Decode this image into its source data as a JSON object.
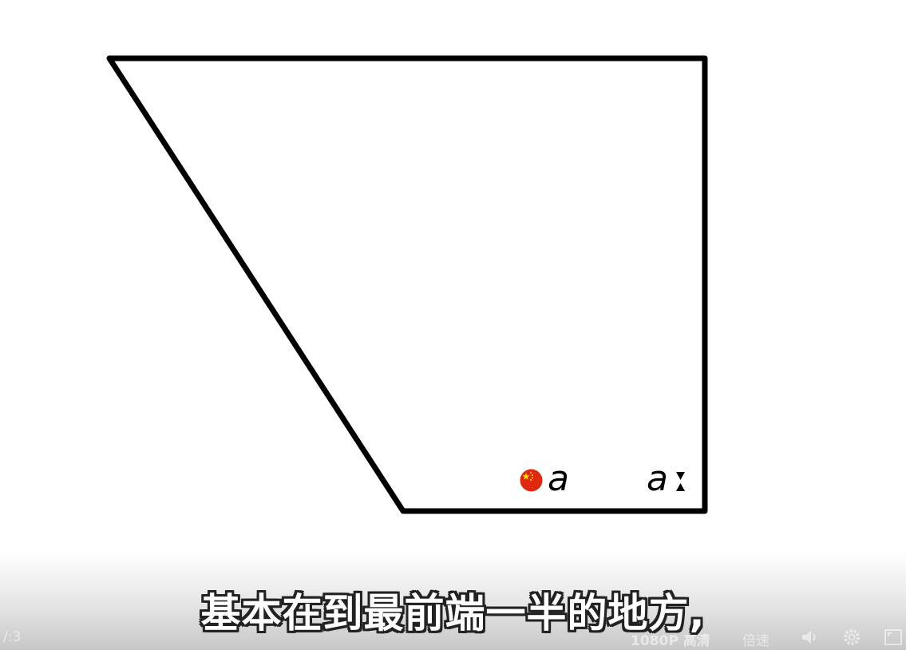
{
  "diagram": {
    "labels": [
      "a",
      "a"
    ],
    "icons": [
      "china-flag-icon",
      "hourglass-icon"
    ]
  },
  "subtitle": {
    "text": "基本在到最前端一半的地方,"
  },
  "player": {
    "time": "/:3",
    "quality": "1080P 高清",
    "speed": "倍速",
    "icons": [
      "volume-icon",
      "settings-icon",
      "fullscreen-icon"
    ]
  },
  "colors": {
    "background": "#ffffff",
    "stroke": "#000000",
    "flag_red": "#de2910",
    "flag_yellow": "#ffde00",
    "subtitle_fill": "#ffffff",
    "subtitle_outline": "#222222"
  }
}
